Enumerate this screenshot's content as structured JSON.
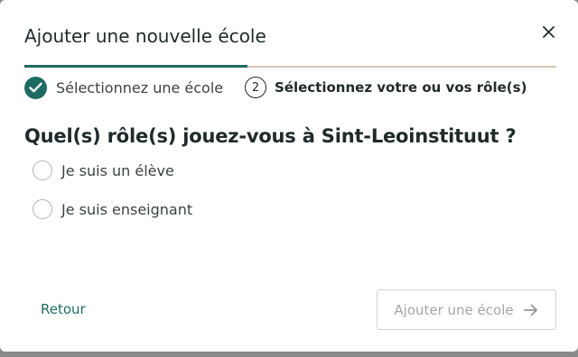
{
  "dialog": {
    "title": "Ajouter une nouvelle école",
    "close_icon": "close-icon"
  },
  "stepper": {
    "progress_fraction": 0.42,
    "steps": [
      {
        "label": "Sélectionnez une école",
        "state": "completed",
        "icon": "check-circle-icon"
      },
      {
        "number": "2",
        "label": "Sélectionnez votre ou vos rôle(s)",
        "state": "current"
      }
    ]
  },
  "question": "Quel(s) rôle(s) jouez-vous à Sint-Leoinstituut ?",
  "options": [
    {
      "label": "Je suis un élève",
      "checked": false
    },
    {
      "label": "Je suis enseignant",
      "checked": false
    }
  ],
  "footer": {
    "back_label": "Retour",
    "submit_label": "Ajouter une école",
    "submit_icon": "arrow-right-icon",
    "submit_disabled": true
  },
  "colors": {
    "accent": "#1e6b63",
    "text": "#1f2a2b",
    "track": "#d8c6b7",
    "disabled_text": "#a9a5a2"
  }
}
